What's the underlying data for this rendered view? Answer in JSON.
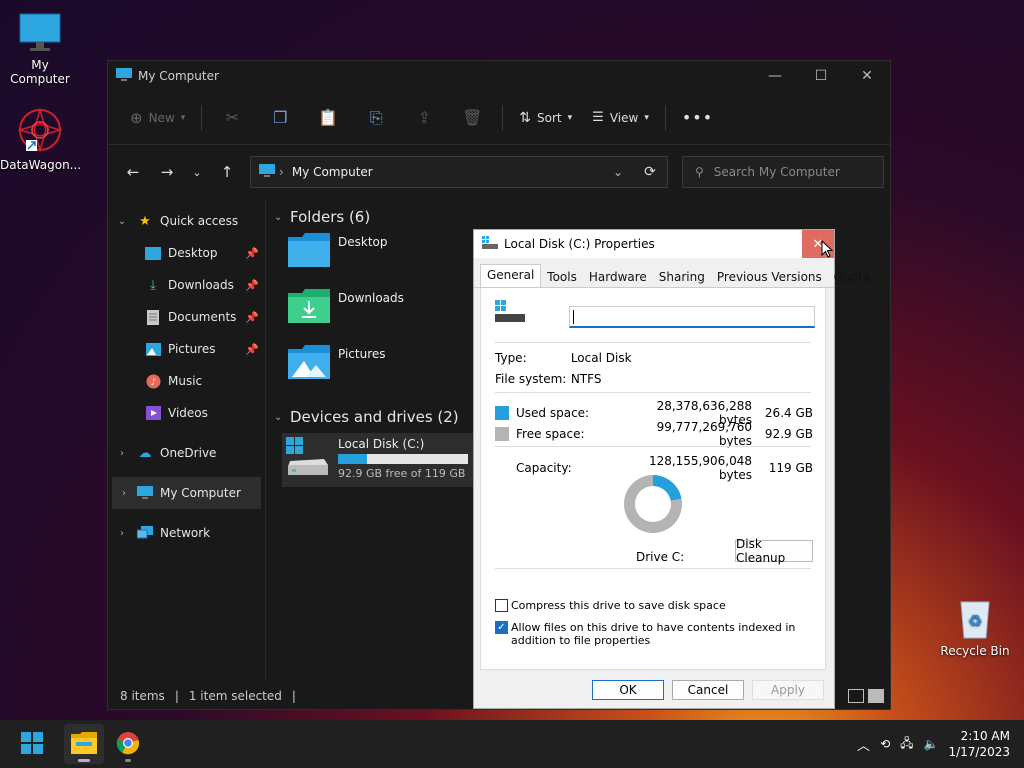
{
  "desktop": {
    "icons": [
      {
        "label": "My Computer"
      },
      {
        "label": "DataWagon..."
      },
      {
        "label": "Recycle Bin"
      }
    ]
  },
  "explorer": {
    "title": "My Computer",
    "toolbar": {
      "new_label": "New",
      "sort_label": "Sort",
      "view_label": "View"
    },
    "address": {
      "location": "My Computer"
    },
    "search": {
      "placeholder": "Search My Computer"
    },
    "nav": {
      "quick_access": "Quick access",
      "items": [
        {
          "label": "Desktop"
        },
        {
          "label": "Downloads"
        },
        {
          "label": "Documents"
        },
        {
          "label": "Pictures"
        },
        {
          "label": "Music"
        },
        {
          "label": "Videos"
        }
      ],
      "onedrive": "OneDrive",
      "my_computer": "My Computer",
      "network": "Network"
    },
    "folders_header": "Folders (6)",
    "folders": [
      {
        "label": "Desktop"
      },
      {
        "label": "Downloads"
      },
      {
        "label": "Pictures"
      }
    ],
    "devices_header": "Devices and drives (2)",
    "drive": {
      "name": "Local Disk (C:)",
      "free_text": "92.9 GB free of 119 GB",
      "used_fraction": 0.22
    },
    "status": {
      "items": "8 items",
      "selected": "1 item selected"
    }
  },
  "dialog": {
    "title": "Local Disk (C:) Properties",
    "tabs": [
      "General",
      "Tools",
      "Hardware",
      "Sharing",
      "Previous Versions",
      "Quota"
    ],
    "type_label": "Type:",
    "type_value": "Local Disk",
    "fs_label": "File system:",
    "fs_value": "NTFS",
    "used_label": "Used space:",
    "used_bytes": "28,378,636,288 bytes",
    "used_gb": "26.4 GB",
    "free_label": "Free space:",
    "free_bytes": "99,777,269,760 bytes",
    "free_gb": "92.9 GB",
    "capacity_label": "Capacity:",
    "capacity_bytes": "128,155,906,048 bytes",
    "capacity_gb": "119 GB",
    "used_fraction": 0.22,
    "drive_label": "Drive C:",
    "cleanup_label": "Disk Cleanup",
    "compress_label": "Compress this drive to save disk space",
    "compress_checked": false,
    "index_label": "Allow files on this drive to have contents indexed in addition to file properties",
    "index_checked": true,
    "ok_label": "OK",
    "cancel_label": "Cancel",
    "apply_label": "Apply",
    "colors": {
      "used": "#26a0da",
      "free": "#b4b4b4"
    }
  },
  "taskbar": {
    "time": "2:10 AM",
    "date": "1/17/2023"
  }
}
